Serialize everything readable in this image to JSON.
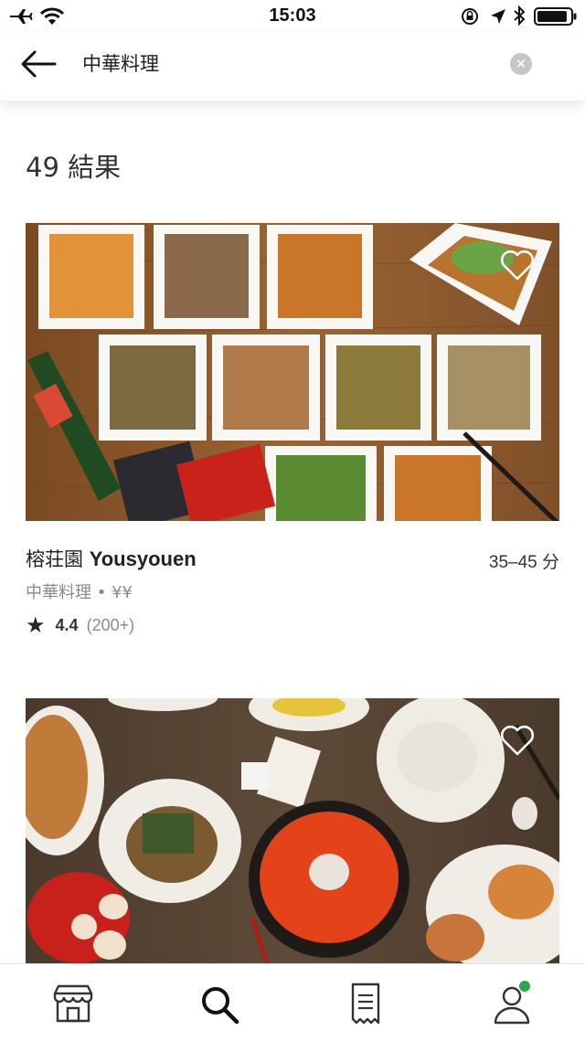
{
  "status_bar": {
    "time": "15:03"
  },
  "search": {
    "query": "中華料理"
  },
  "results": {
    "count_text": "49 結果"
  },
  "restaurants": [
    {
      "name_jp": "榕荘園",
      "name_en": "Yousyouen",
      "eta": "35–45 分",
      "category": "中華料理",
      "separator": "•",
      "price": "¥¥",
      "rating": "4.4",
      "rating_count": "(200+)"
    },
    {
      "name_jp": "",
      "name_en": "",
      "eta": "",
      "category": "",
      "separator": "",
      "price": "",
      "rating": "",
      "rating_count": ""
    }
  ],
  "bottom_nav": {
    "items": [
      {
        "icon": "store-icon"
      },
      {
        "icon": "search-icon"
      },
      {
        "icon": "receipt-icon"
      },
      {
        "icon": "account-icon",
        "badge_color": "#27a84a"
      }
    ]
  },
  "colors": {
    "accent_green": "#27a84a",
    "text_primary": "#262626",
    "text_secondary": "#8a8a8a"
  }
}
